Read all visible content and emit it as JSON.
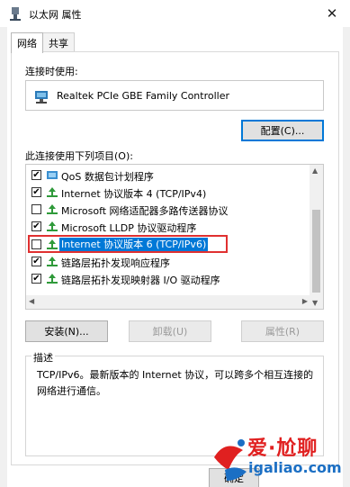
{
  "window": {
    "title": "以太网 属性",
    "close_glyph": "✕"
  },
  "tabs": [
    {
      "label": "网络",
      "active": true
    },
    {
      "label": "共享",
      "active": false
    }
  ],
  "connect_using": {
    "label": "连接时使用:",
    "adapter_name": "Realtek PCIe GBE Family Controller",
    "configure_button": "配置(C)..."
  },
  "items_section": {
    "label": "此连接使用下列项目(O):",
    "items": [
      {
        "checked": true,
        "icon": "service-icon",
        "label": "QoS 数据包计划程序"
      },
      {
        "checked": true,
        "icon": "protocol-icon",
        "label": "Internet 协议版本 4 (TCP/IPv4)"
      },
      {
        "checked": false,
        "icon": "protocol-icon",
        "label": "Microsoft 网络适配器多路传送器协议"
      },
      {
        "checked": true,
        "icon": "protocol-icon",
        "label": "Microsoft LLDP 协议驱动程序"
      },
      {
        "checked": false,
        "icon": "protocol-icon",
        "label": "Internet 协议版本 6 (TCP/IPv6)",
        "selected": true
      },
      {
        "checked": true,
        "icon": "protocol-icon",
        "label": "链路层拓扑发现响应程序"
      },
      {
        "checked": true,
        "icon": "protocol-icon",
        "label": "链路层拓扑发现映射器 I/O 驱动程序"
      }
    ]
  },
  "buttons": {
    "install": "安装(N)...",
    "uninstall": "卸载(U)",
    "properties": "属性(R)"
  },
  "description": {
    "legend": "描述",
    "text": "TCP/IPv6。最新版本的 Internet 协议，可以跨多个相互连接的网络进行通信。"
  },
  "footer": {
    "ok_partial": "确定"
  },
  "watermark": {
    "line1": "爱·尬聊",
    "line2": "igaliao.com"
  },
  "colors": {
    "selection": "#0078d7",
    "highlight_box": "#e03030",
    "focus_border": "#0078d7"
  }
}
